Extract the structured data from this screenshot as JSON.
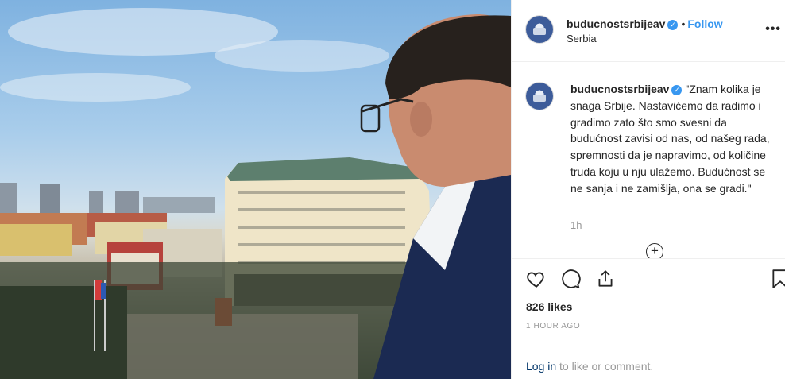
{
  "photo": {
    "alt": ""
  },
  "header": {
    "username": "buducnostsrbijeav",
    "separator": "•",
    "follow_label": "Follow",
    "location": "Serbia",
    "more_label": "•••"
  },
  "caption": {
    "username": "buducnostsrbijeav",
    "text": "\"Znam kolika je snaga Srbije. Nastavićemo da radimo i gradimo zato što smo svesni da budućnost zavisi od nas, od našeg rada, spremnosti da je napravimo, od količine truda koju u nju ulažemo. Budućnost se ne sanja i ne zamišlja, ona se gradi.\"",
    "time_ago": "1h"
  },
  "load_more": {
    "label": "+"
  },
  "actions": {
    "like": "heart-icon",
    "comment": "comment-icon",
    "share": "share-icon",
    "save": "bookmark-icon"
  },
  "likes": "826 likes",
  "post_time": "1 HOUR AGO",
  "footer": {
    "login_link": "Log in",
    "login_rest": "to like or comment."
  },
  "colors": {
    "accent": "#3897f0",
    "text": "#262626",
    "muted": "#999999",
    "link": "#003569"
  }
}
